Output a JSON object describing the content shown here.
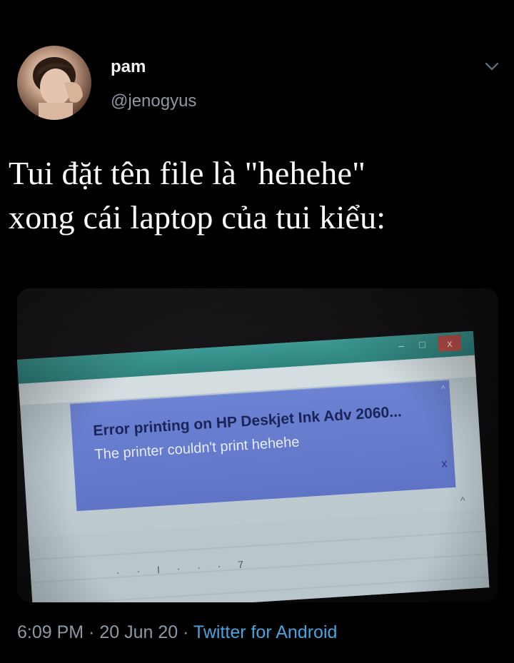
{
  "author": {
    "display_name": "pam",
    "handle": "@jenogyus"
  },
  "tweet": {
    "text_line1": "Tui đặt tên file là \"hehehe\"",
    "text_line2": "xong cái laptop của tui kiểu:"
  },
  "photo": {
    "window_controls": {
      "minimize": "–",
      "maximize": "□",
      "close": "x"
    },
    "notification": {
      "title": "Error printing on HP Deskjet Ink Adv 2060...",
      "body": "The printer couldn't print hehehe",
      "close": "x"
    },
    "ruler_text": "· · I · · · 7"
  },
  "footer": {
    "time": "6:09 PM",
    "separator1": " · ",
    "date": "20 Jun 20",
    "separator2": " · ",
    "source": "Twitter for Android"
  },
  "icons": {
    "menu": "chevron-down-icon",
    "avatar": "avatar"
  },
  "colors": {
    "background": "#000000",
    "handle": "#8b98a5",
    "link": "#4aa3df",
    "notification": "#6479c9"
  }
}
